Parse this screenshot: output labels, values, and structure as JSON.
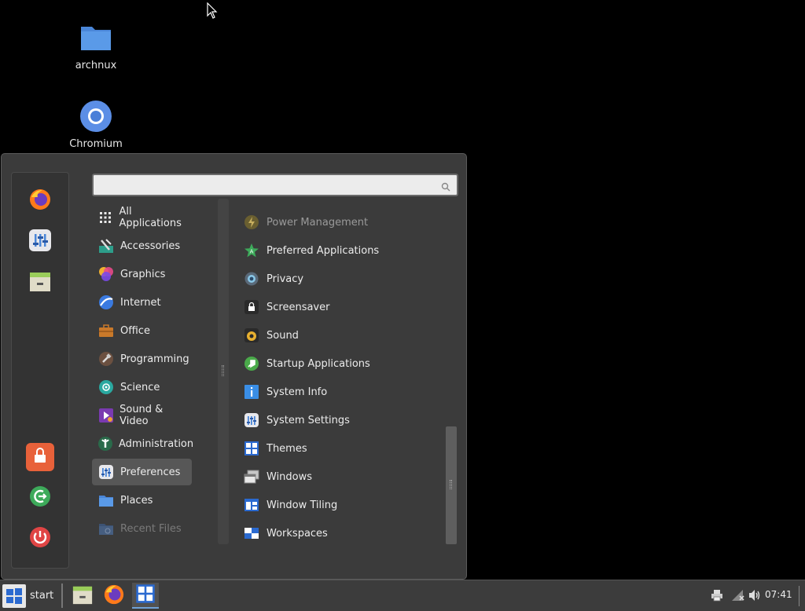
{
  "desktop": {
    "icons": [
      {
        "label": "archnux",
        "icon": "folder-icon"
      },
      {
        "label": "Chromium",
        "icon": "chromium-icon"
      }
    ]
  },
  "menu": {
    "search": {
      "value": "",
      "placeholder": ""
    },
    "favorites": [
      {
        "name": "Firefox",
        "icon": "firefox-icon"
      },
      {
        "name": "System Settings",
        "icon": "settings-icon"
      },
      {
        "name": "Files",
        "icon": "file-manager-icon"
      }
    ],
    "session": [
      {
        "name": "Lock Screen",
        "icon": "lock-icon"
      },
      {
        "name": "Log Out",
        "icon": "logout-icon"
      },
      {
        "name": "Quit",
        "icon": "power-icon"
      }
    ],
    "categories": [
      {
        "label": "All Applications",
        "icon": "grid-icon"
      },
      {
        "label": "Accessories",
        "icon": "accessories-icon"
      },
      {
        "label": "Graphics",
        "icon": "graphics-icon"
      },
      {
        "label": "Internet",
        "icon": "internet-icon"
      },
      {
        "label": "Office",
        "icon": "office-icon"
      },
      {
        "label": "Programming",
        "icon": "programming-icon"
      },
      {
        "label": "Science",
        "icon": "science-icon"
      },
      {
        "label": "Sound & Video",
        "icon": "sound-video-icon"
      },
      {
        "label": "Administration",
        "icon": "administration-icon"
      },
      {
        "label": "Preferences",
        "icon": "preferences-icon",
        "selected": true
      },
      {
        "label": "Places",
        "icon": "places-folder-icon"
      },
      {
        "label": "Recent Files",
        "icon": "recent-files-icon",
        "disabled": true
      }
    ],
    "apps": [
      {
        "label": "Power Management",
        "icon": "power-management-icon",
        "partial": true
      },
      {
        "label": "Preferred Applications",
        "icon": "preferred-applications-icon"
      },
      {
        "label": "Privacy",
        "icon": "privacy-icon"
      },
      {
        "label": "Screensaver",
        "icon": "screensaver-icon"
      },
      {
        "label": "Sound",
        "icon": "sound-icon"
      },
      {
        "label": "Startup Applications",
        "icon": "startup-applications-icon"
      },
      {
        "label": "System Info",
        "icon": "system-info-icon"
      },
      {
        "label": "System Settings",
        "icon": "system-settings-icon"
      },
      {
        "label": "Themes",
        "icon": "themes-icon"
      },
      {
        "label": "Windows",
        "icon": "windows-icon"
      },
      {
        "label": "Window Tiling",
        "icon": "window-tiling-icon"
      },
      {
        "label": "Workspaces",
        "icon": "workspaces-icon"
      }
    ]
  },
  "panel": {
    "start_label": "start",
    "launchers": [
      "file-manager-icon",
      "firefox-icon",
      "workspace-switcher-icon"
    ],
    "tray": [
      "printer-icon",
      "network-icon",
      "volume-icon"
    ],
    "clock": "07:41"
  },
  "colors": {
    "menu_bg": "#3b3b3b",
    "selected_bg": "#575757",
    "panel_bg": "#3c3c3c",
    "accent": "#6fa1d6"
  }
}
